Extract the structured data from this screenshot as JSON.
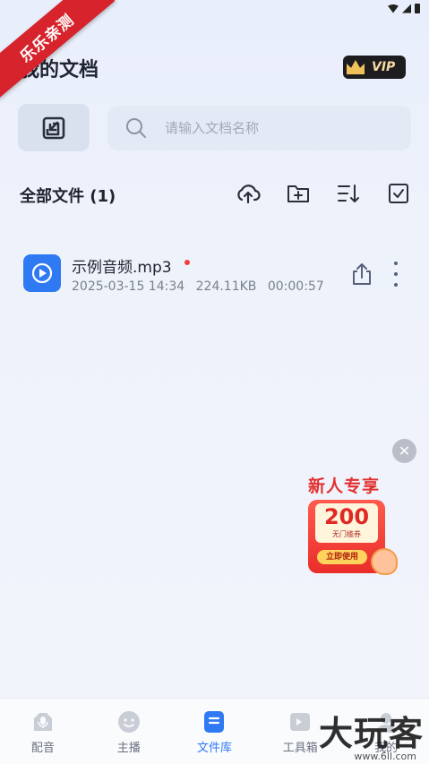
{
  "watermark": {
    "ribbon_text": "乐乐亲测",
    "logo_text": "大玩客",
    "logo_sub": "www.6ll.com"
  },
  "header": {
    "title": "我的文档",
    "vip_label": "VIP"
  },
  "search": {
    "placeholder": "请输入文档名称",
    "value": ""
  },
  "section": {
    "title": "全部文件 (1)"
  },
  "toolbar": {
    "icons": [
      "cloud-upload-icon",
      "new-folder-icon",
      "sort-icon",
      "select-icon"
    ]
  },
  "files": [
    {
      "name": "示例音频.mp3",
      "date": "2025-03-15 14:34",
      "size": "224.11KB",
      "duration": "00:00:57",
      "unread": true
    }
  ],
  "promo": {
    "title": "新人专享",
    "amount": "200",
    "subtitle": "无门槛券",
    "button": "立即使用"
  },
  "nav": {
    "items": [
      {
        "label": "配音",
        "icon": "microphone-icon",
        "active": false
      },
      {
        "label": "主播",
        "icon": "face-icon",
        "active": false
      },
      {
        "label": "文件库",
        "icon": "document-icon",
        "active": true
      },
      {
        "label": "工具箱",
        "icon": "toolbox-icon",
        "active": false
      },
      {
        "label": "我的",
        "icon": "profile-icon",
        "active": false
      }
    ]
  },
  "colors": {
    "accent": "#2f7af3",
    "promo_red": "#e2302f",
    "dot_red": "#f13f3f"
  }
}
